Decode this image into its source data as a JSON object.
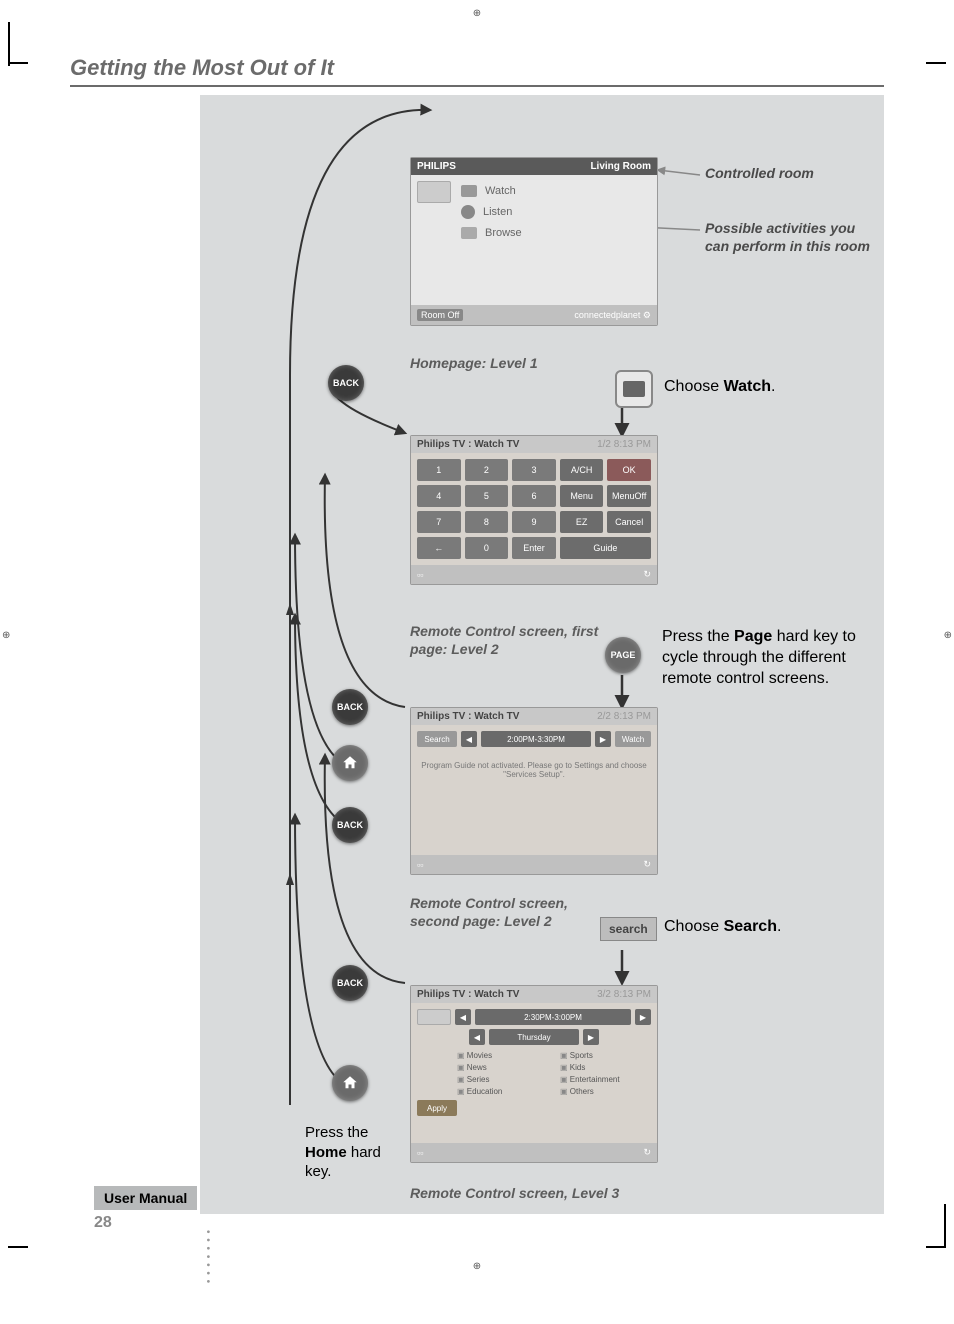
{
  "page": {
    "header": "Getting the Most Out of It",
    "footer_label": "User Manual",
    "page_number": "28"
  },
  "annotations": {
    "controlled_room": "Controlled room",
    "possible_activities": "Possible activities you can perform in this room"
  },
  "level1": {
    "brand": "PHILIPS",
    "location": "Living Room",
    "activities": {
      "watch": "Watch",
      "listen": "Listen",
      "browse": "Browse"
    },
    "room_off": "Room Off",
    "footer": "connectedplanet",
    "caption": "Homepage: Level 1"
  },
  "instructions": {
    "choose_watch_pre": "Choose ",
    "choose_watch_bold": "Watch",
    "page_pre": "Press the ",
    "page_bold": "Page",
    "page_post": " hard key to cycle through the different remote control screens.",
    "choose_search_pre": "Choose ",
    "choose_search_bold": "Search",
    "home_pre": "Press the ",
    "home_bold": "Home",
    "home_post": " hard key."
  },
  "level2a": {
    "title": "Philips TV : Watch TV",
    "time": "1/2  8:13 PM",
    "keys": {
      "k1": "1",
      "k2": "2",
      "k3": "3",
      "avch": "A/CH",
      "ok": "OK",
      "k4": "4",
      "k5": "5",
      "k6": "6",
      "menu": "Menu",
      "menuoff": "MenuOff",
      "k7": "7",
      "k8": "8",
      "k9": "9",
      "ez": "EZ",
      "cancel": "Cancel",
      "back": "←",
      "k0": "0",
      "enter": "Enter",
      "guide": "Guide"
    },
    "caption": "Remote Control screen, first page: Level 2"
  },
  "buttons": {
    "back": "BACK",
    "page": "PAGE",
    "search": "search"
  },
  "level2b": {
    "title": "Philips TV : Watch TV",
    "time": "2/2  8:13 PM",
    "search": "Search",
    "timeslot": "2:00PM-3:30PM",
    "refresh": "Watch",
    "message": "Program Guide not activated. Please go to Settings and choose \"Services Setup\".",
    "caption": "Remote Control screen, second page: Level 2"
  },
  "level3": {
    "title": "Philips TV : Watch TV",
    "time": "3/2  8:13 PM",
    "timeslot": "2:30PM-3:00PM",
    "day": "Thursday",
    "categories": {
      "movies": "Movies",
      "sports": "Sports",
      "news": "News",
      "kids": "Kids",
      "series": "Series",
      "entertainment": "Entertainment",
      "education": "Education",
      "others": "Others"
    },
    "apply": "Apply",
    "caption": "Remote Control screen, Level 3"
  }
}
